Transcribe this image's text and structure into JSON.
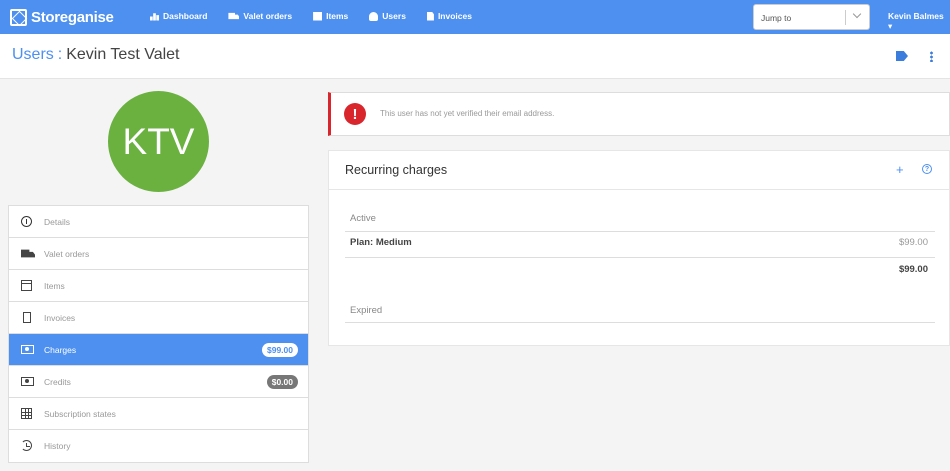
{
  "brand": {
    "name": "Storeganise"
  },
  "nav": {
    "items": [
      {
        "label": "Dashboard"
      },
      {
        "label": "Valet orders"
      },
      {
        "label": "Items"
      },
      {
        "label": "Users"
      },
      {
        "label": "Invoices"
      }
    ]
  },
  "jump": {
    "placeholder": "Jump to"
  },
  "account": {
    "name": "Kevin Balmes ▾"
  },
  "breadcrumb": {
    "section": "Users",
    "separator": ":",
    "current": "Kevin Test Valet"
  },
  "profile": {
    "initials": "KTV",
    "avatar_color": "#6ab140"
  },
  "sidebar": {
    "items": [
      {
        "label": "Details",
        "icon": "info-circle-icon"
      },
      {
        "label": "Valet orders",
        "icon": "truck-icon"
      },
      {
        "label": "Items",
        "icon": "archive-box-icon"
      },
      {
        "label": "Invoices",
        "icon": "invoice-doc-icon"
      },
      {
        "label": "Charges",
        "icon": "money-icon",
        "badge": "$99.00",
        "active": true
      },
      {
        "label": "Credits",
        "icon": "money-icon",
        "badge": "$0.00"
      },
      {
        "label": "Subscription states",
        "icon": "table-grid-icon"
      },
      {
        "label": "History",
        "icon": "history-icon"
      }
    ]
  },
  "alert": {
    "text": "This user has not yet verified their email address.",
    "icon": "exclamation-icon",
    "color": "#d9262c"
  },
  "charges": {
    "title": "Recurring charges",
    "active_label": "Active",
    "items": [
      {
        "name": "Plan: Medium",
        "price": "$99.00"
      }
    ],
    "total": "$99.00",
    "expired_label": "Expired"
  },
  "colors": {
    "primary": "#4d90f0",
    "danger": "#d9262c"
  }
}
